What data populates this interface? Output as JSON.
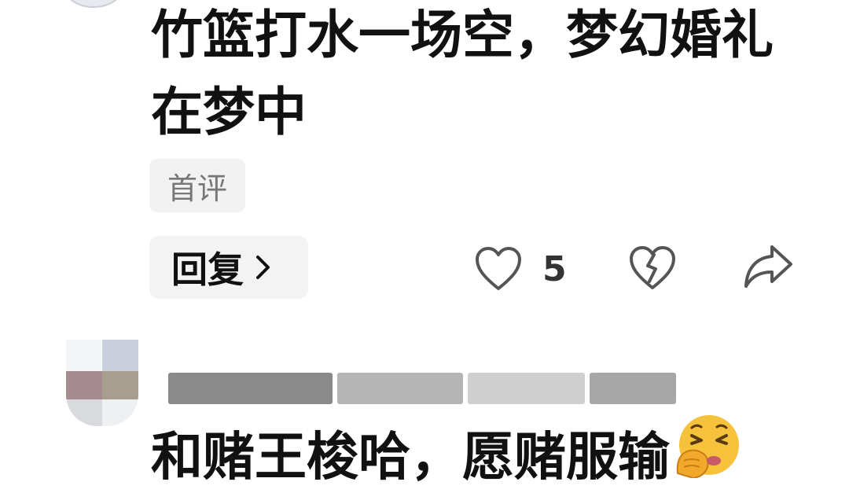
{
  "comments": [
    {
      "text": "竹篮打水一场空，梦幻婚礼在梦中",
      "badge": "首评",
      "reply_label": "回复",
      "like_count": "5"
    },
    {
      "text": "和赌王梭哈，愿赌服输",
      "emoji": "yawning-hand-over-mouth-emoji"
    }
  ],
  "icons": {
    "like": "heart-outline-icon",
    "dislike": "broken-heart-icon",
    "share": "share-arrow-icon",
    "reply_chevron": "chevron-right-icon"
  },
  "colors": {
    "text": "#111111",
    "muted": "#777777",
    "button_bg": "#f3f3f3",
    "icon": "#555555"
  }
}
